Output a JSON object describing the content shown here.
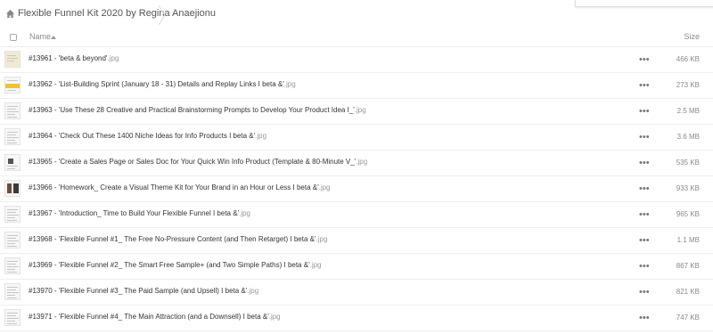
{
  "breadcrumb": {
    "icon": "home-icon",
    "title": "Flexible Funnel Kit 2020 by Regina Anaejionu"
  },
  "header": {
    "name_label": "Name",
    "size_label": "Size"
  },
  "files": [
    {
      "name": "#13961 - 'beta & beyond'",
      "ext": ".jpg",
      "size": "466 KB",
      "thumb": "tan"
    },
    {
      "name": "#13962 - 'List-Building Sprint (January 18 - 31) Details and Replay Links I beta &'",
      "ext": ".jpg",
      "size": "273 KB",
      "thumb": "yellow"
    },
    {
      "name": "#13963 - 'Use These 28 Creative and Practical Brainstorming Prompts to Develop Your Product Idea I_'",
      "ext": ".jpg",
      "size": "2.5 MB",
      "thumb": "doc"
    },
    {
      "name": "#13964 - 'Check Out These 1400 Niche Ideas for Info Products I beta &'",
      "ext": ".jpg",
      "size": "3.6 MB",
      "thumb": "doc"
    },
    {
      "name": "#13965 - 'Create a Sales Page or Sales Doc for Your Quick Win Info Product (Template & 80-Minute V_'",
      "ext": ".jpg",
      "size": "535 KB",
      "thumb": "dark"
    },
    {
      "name": "#13966 - 'Homework_ Create a Visual Theme Kit for Your Brand in an Hour or Less I beta &'",
      "ext": ".jpg",
      "size": "933 KB",
      "thumb": "photo"
    },
    {
      "name": "#13967 - 'Introduction_ Time to Build Your Flexible Funnel I beta &'",
      "ext": ".jpg",
      "size": "965 KB",
      "thumb": "doc"
    },
    {
      "name": "#13968 - 'Flexible Funnel #1_ The Free No-Pressure Content (and Then Retarget) I beta &'",
      "ext": ".jpg",
      "size": "1.1 MB",
      "thumb": "doc"
    },
    {
      "name": "#13969 - 'Flexible Funnel #2_ The Smart Free Sample+ (and Two Simple Paths) I beta &'",
      "ext": ".jpg",
      "size": "867 KB",
      "thumb": "doc"
    },
    {
      "name": "#13970 - 'Flexible Funnel #3_ The Paid Sample (and Upsell) I beta &'",
      "ext": ".jpg",
      "size": "821 KB",
      "thumb": "doc"
    },
    {
      "name": "#13971 - 'Flexible Funnel #4_ The Main Attraction (and a Downsell) I beta &'",
      "ext": ".jpg",
      "size": "747 KB",
      "thumb": "doc"
    }
  ],
  "row_menu_glyph": "•••",
  "colors": {
    "text": "#333333",
    "muted": "#8a8a8a",
    "border": "#efefef",
    "accent_yellow": "#f2c230"
  }
}
